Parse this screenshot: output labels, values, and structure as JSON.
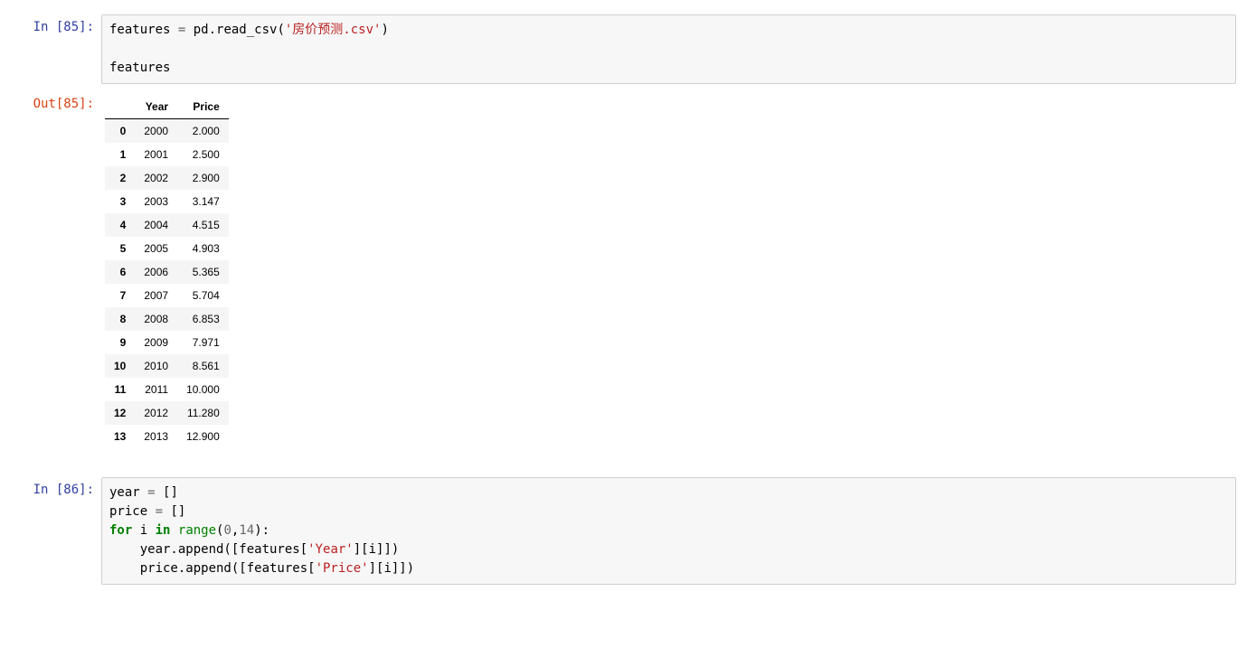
{
  "cell1": {
    "in_prompt": "In  [85]:",
    "out_prompt": "Out[85]:",
    "code_line1_a": "features ",
    "code_line1_b": "=",
    "code_line1_c": " pd.read_csv(",
    "code_line1_d": "'房价预测.csv'",
    "code_line1_e": ")",
    "code_line3": "features",
    "table": {
      "headers": [
        "Year",
        "Price"
      ],
      "rows": [
        {
          "idx": "0",
          "year": "2000",
          "price": "2.000"
        },
        {
          "idx": "1",
          "year": "2001",
          "price": "2.500"
        },
        {
          "idx": "2",
          "year": "2002",
          "price": "2.900"
        },
        {
          "idx": "3",
          "year": "2003",
          "price": "3.147"
        },
        {
          "idx": "4",
          "year": "2004",
          "price": "4.515"
        },
        {
          "idx": "5",
          "year": "2005",
          "price": "4.903"
        },
        {
          "idx": "6",
          "year": "2006",
          "price": "5.365"
        },
        {
          "idx": "7",
          "year": "2007",
          "price": "5.704"
        },
        {
          "idx": "8",
          "year": "2008",
          "price": "6.853"
        },
        {
          "idx": "9",
          "year": "2009",
          "price": "7.971"
        },
        {
          "idx": "10",
          "year": "2010",
          "price": "8.561"
        },
        {
          "idx": "11",
          "year": "2011",
          "price": "10.000"
        },
        {
          "idx": "12",
          "year": "2012",
          "price": "11.280"
        },
        {
          "idx": "13",
          "year": "2013",
          "price": "12.900"
        }
      ]
    }
  },
  "cell2": {
    "in_prompt": "In  [86]:",
    "l1_a": "year ",
    "l1_b": "=",
    "l1_c": " []",
    "l2_a": "price ",
    "l2_b": "=",
    "l2_c": " []",
    "l3_a": "for",
    "l3_b": " i ",
    "l3_c": "in",
    "l3_d": " ",
    "l3_e": "range",
    "l3_f": "(",
    "l3_g": "0",
    "l3_h": ",",
    "l3_i": "14",
    "l3_j": "):",
    "l4_a": "    year.append([features[",
    "l4_b": "'Year'",
    "l4_c": "][i]])",
    "l5_a": "    price.append([features[",
    "l5_b": "'Price'",
    "l5_c": "][i]])"
  }
}
